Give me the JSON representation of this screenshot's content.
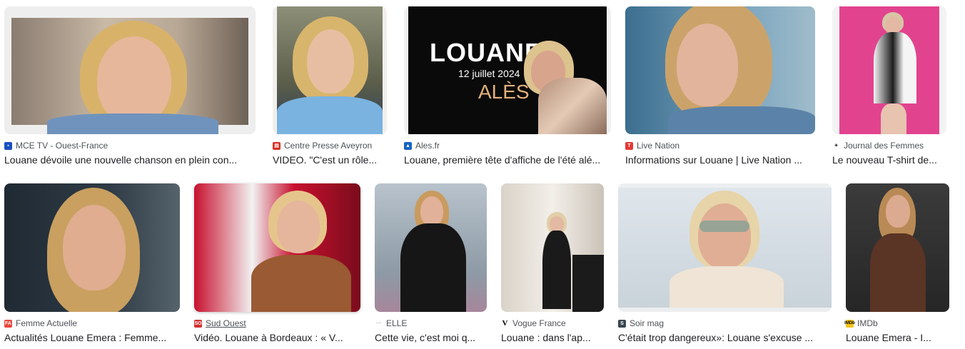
{
  "results": [
    {
      "source": "MCE TV - Ouest-France",
      "title": "Louane dévoile une nouvelle chanson en plein con...",
      "favicon": "mce-icon",
      "fav_color": "#1a4fbf"
    },
    {
      "source": "Centre Presse Aveyron",
      "title": "VIDEO. \"C'est un rôle...",
      "favicon": "centre-presse-icon",
      "fav_color": "#d93025"
    },
    {
      "source": "Ales.fr",
      "title": "Louane, première tête d'affiche de l'été alé...",
      "favicon": "ales-icon",
      "fav_color": "#1565c0"
    },
    {
      "source": "Live Nation",
      "title": "Informations sur Louane | Live Nation ...",
      "favicon": "live-nation-icon",
      "fav_color": "#e53935"
    },
    {
      "source": "Journal des Femmes",
      "title": "Le nouveau T-shirt de...",
      "favicon": "journal-des-femmes-icon",
      "fav_color": "#333333"
    },
    {
      "source": "Femme Actuelle",
      "title": "Actualités Louane Emera : Femme...",
      "favicon": "femme-actuelle-icon",
      "fav_color": "#e8453c"
    },
    {
      "source": "Sud Ouest",
      "title": "Vidéo. Louane à Bordeaux : « V...",
      "favicon": "sud-ouest-icon",
      "fav_color": "#d32f2f"
    },
    {
      "source": "ELLE",
      "title": "Cette vie, c'est moi q...",
      "favicon": "elle-icon",
      "fav_color": "#9e9e9e"
    },
    {
      "source": "Vogue France",
      "title": "Louane : dans l'ap...",
      "favicon": "vogue-icon",
      "fav_color": "#000000"
    },
    {
      "source": "Soir mag",
      "title": "C'était trop dangereux»: Louane s'excuse ...",
      "favicon": "soir-mag-icon",
      "fav_color": "#37474f"
    },
    {
      "source": "IMDb",
      "title": "Louane Emera - I...",
      "favicon": "imdb-icon",
      "fav_color": "#f5c518"
    }
  ],
  "poster": {
    "headline": "LOUANE",
    "date": "12 juillet 2024",
    "city": "ALÈS"
  },
  "colors": {
    "source_text": "#4d5156",
    "title_text": "#202124"
  }
}
